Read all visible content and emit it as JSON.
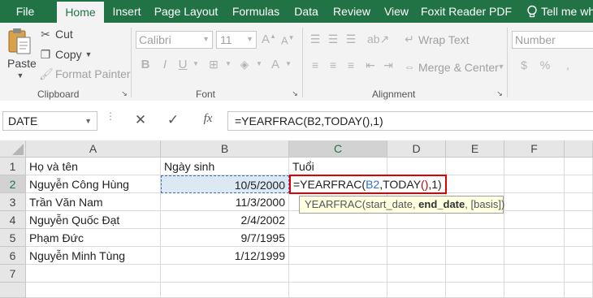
{
  "tabs": [
    "File",
    "Home",
    "Insert",
    "Page Layout",
    "Formulas",
    "Data",
    "Review",
    "View",
    "Foxit Reader PDF"
  ],
  "tell_me": "Tell me wha",
  "clipboard": {
    "paste": "Paste",
    "cut": "Cut",
    "copy": "Copy",
    "format_painter": "Format Painter",
    "label": "Clipboard"
  },
  "font": {
    "name": "Calibri",
    "size": "11",
    "bold": "B",
    "italic": "I",
    "underline": "U",
    "label": "Font"
  },
  "alignment": {
    "wrap_text": "Wrap Text",
    "merge_center": "Merge & Center",
    "label": "Alignment"
  },
  "number": {
    "format": "Number"
  },
  "formula_bar": {
    "name_box": "DATE",
    "formula": "=YEARFRAC(B2,TODAY(),1)",
    "fx": "fx"
  },
  "columns": [
    "A",
    "B",
    "C",
    "D",
    "E",
    "F"
  ],
  "rows": [
    "1",
    "2",
    "3",
    "4",
    "5",
    "6",
    "7"
  ],
  "cells": {
    "A1": "Họ và tên",
    "B1": "Ngày sinh",
    "C1": "Tuổi",
    "A2": "Nguyễn Công Hùng",
    "B2": "10/5/2000",
    "A3": "Trần Văn Nam",
    "B3": "11/3/2000",
    "A4": "Nguyễn Quốc Đạt",
    "B4": "2/4/2002",
    "A5": "Phạm Đức",
    "B5": "9/7/1995",
    "A6": "Nguyễn Minh Tùng",
    "B6": "1/12/1999"
  },
  "edit_formula": {
    "prefix": "=YEARFRAC(",
    "ref": "B2",
    "mid": ",TODAY",
    "parens": "()",
    "suffix": ",1)"
  },
  "tooltip": {
    "fn": "YEARFRAC(",
    "arg1": "start_date, ",
    "arg2": "end_date",
    "arg3": ", [basis])"
  },
  "colors": {
    "brand": "#217346",
    "ref": "#2f6fc8",
    "parens": "#c00000",
    "highlight": "#e00000"
  }
}
